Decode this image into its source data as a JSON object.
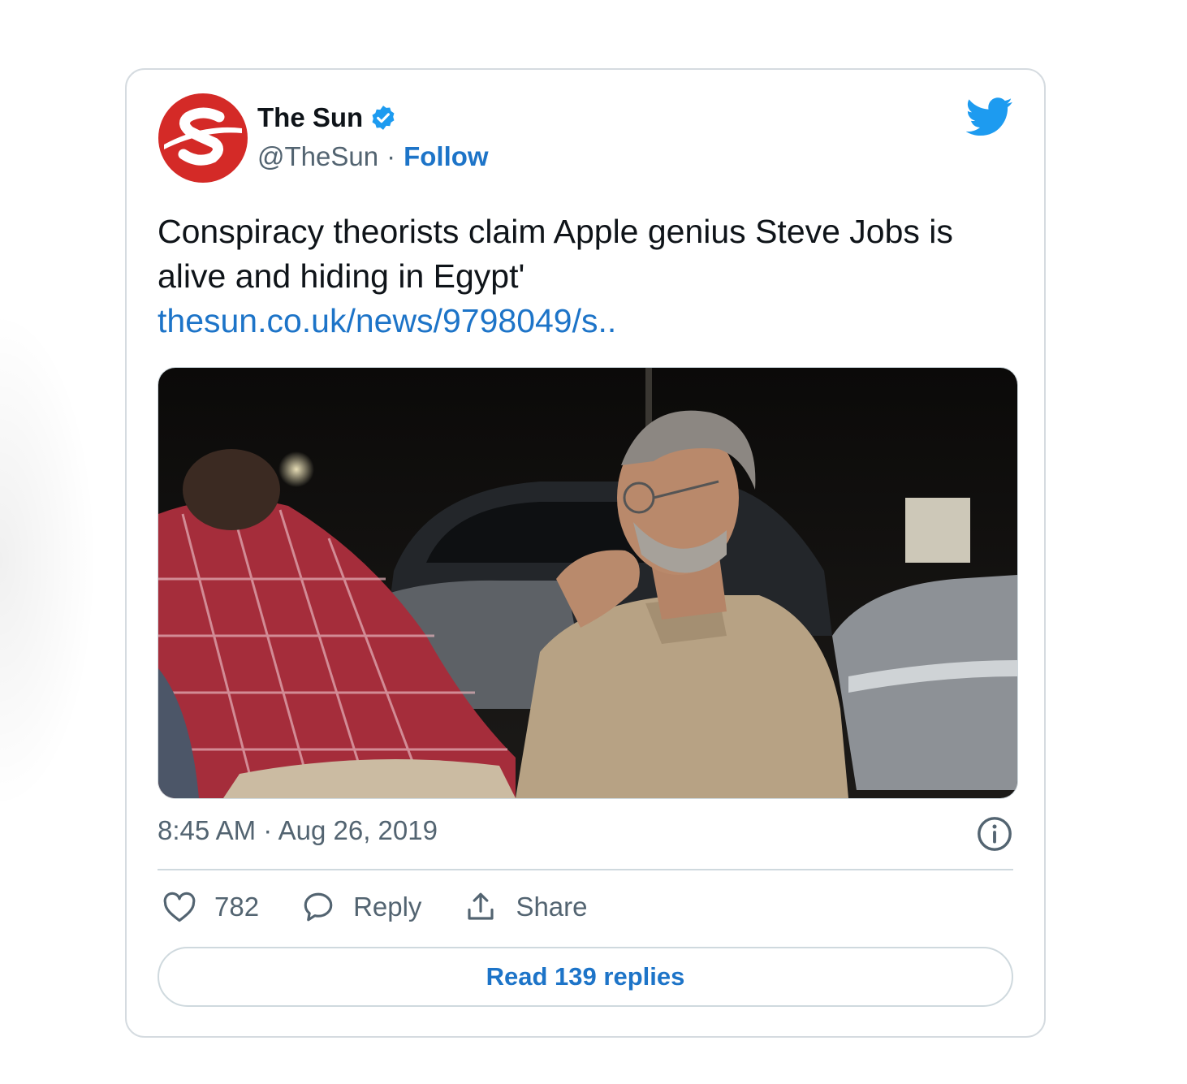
{
  "tweet": {
    "author": {
      "name": "The Sun",
      "handle": "@TheSun",
      "separator": "·",
      "follow_label": "Follow",
      "avatar_icon": "the-sun-logo",
      "verified_icon": "verified-badge-icon"
    },
    "text": "Conspiracy theorists claim Apple genius Steve Jobs is alive and hiding in Egypt'",
    "link": "thesun.co.uk/news/9798049/s..",
    "photo": "Photo of a grey-haired bearded man with glasses in a beige robe, sitting at night beside a person in a red checked shirt, parked cars behind",
    "time": "8:45 AM",
    "date_separator": "·",
    "date": "Aug 26, 2019",
    "actions": {
      "likes": "782",
      "reply_label": "Reply",
      "share_label": "Share"
    },
    "read_replies_label": "Read 139 replies"
  },
  "colors": {
    "accent": "#1d74c8",
    "twitter_blue": "#1d9bf0",
    "text": "#0f1419",
    "muted": "#536471",
    "border": "#cfd9de",
    "logo_red": "#d42a27"
  }
}
